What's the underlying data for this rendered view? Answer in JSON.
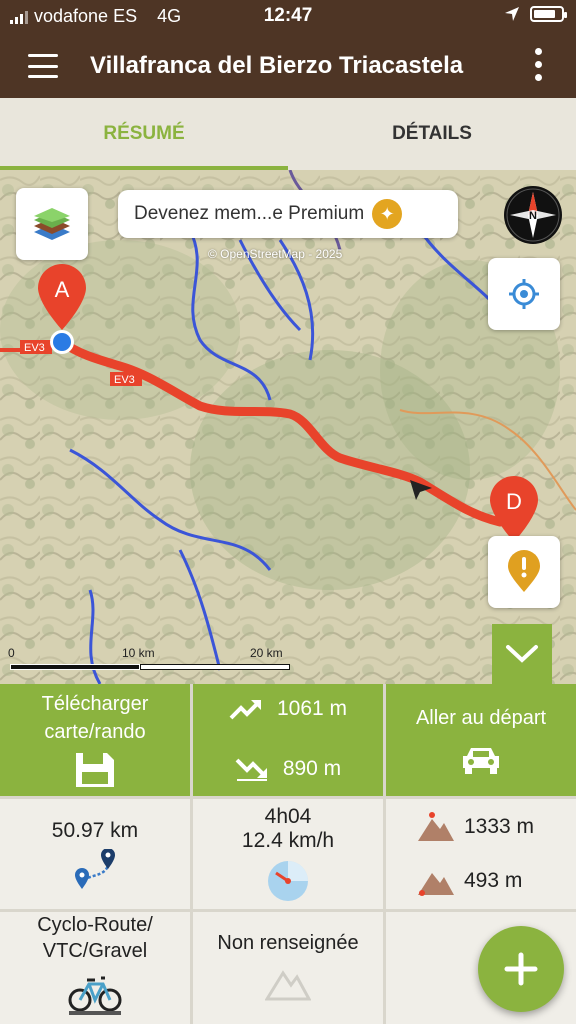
{
  "status_bar": {
    "carrier": "vodafone ES",
    "network": "4G",
    "time": "12:47"
  },
  "header": {
    "title": "Villafranca del Bierzo Triacastela"
  },
  "tabs": [
    {
      "label": "RÉSUMÉ",
      "active": true
    },
    {
      "label": "DÉTAILS",
      "active": false
    }
  ],
  "map": {
    "premium_banner": "Devenez mem...e Premium",
    "attribution": "© OpenStreetMap - 2025",
    "start_marker": "A",
    "end_marker": "D",
    "road_label": "EV3",
    "scale_labels": [
      "0",
      "10 km",
      "20 km"
    ]
  },
  "summary": {
    "download_label": "Télécharger carte/rando",
    "ascent": "1061 m",
    "descent": "890 m",
    "go_to_start_label": "Aller au départ",
    "distance": "50.97 km",
    "duration": "4h04",
    "speed": "12.4 km/h",
    "max_altitude": "1333 m",
    "min_altitude": "493 m",
    "activity": "Cyclo-Route/ VTC/Gravel",
    "difficulty": "Non renseignée"
  },
  "colors": {
    "header_brown": "#4e3525",
    "accent_green": "#8bb33f",
    "route_red": "#e8432b"
  }
}
